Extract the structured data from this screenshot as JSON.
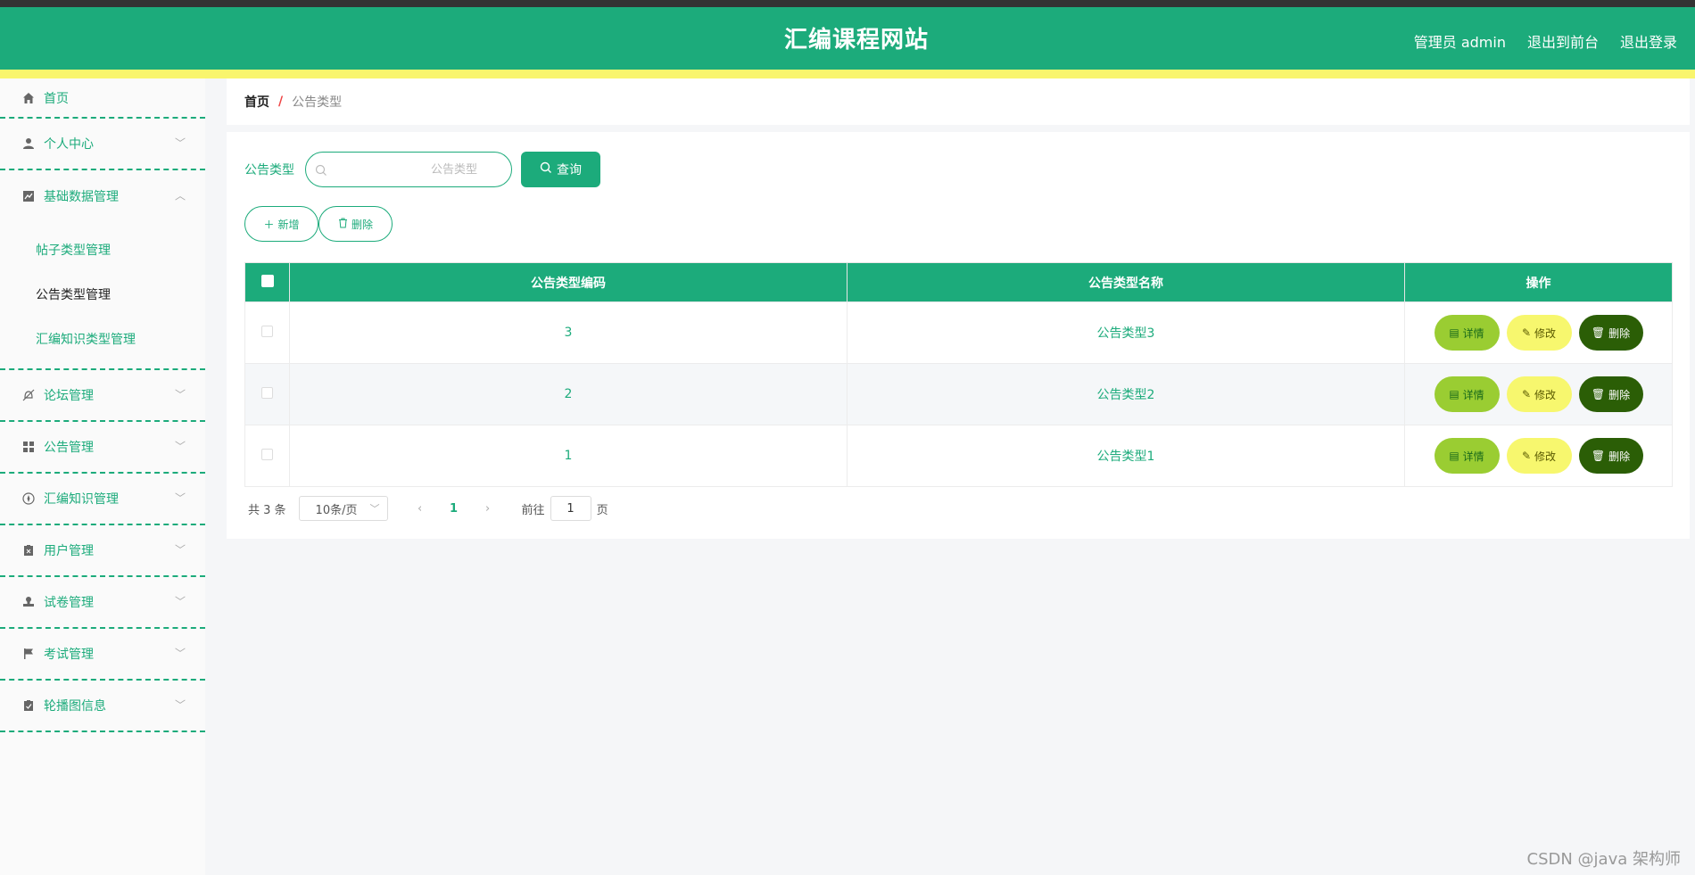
{
  "header": {
    "title": "汇编课程网站",
    "user": "管理员 admin",
    "to_front": "退出到前台",
    "logout": "退出登录"
  },
  "sidebar": {
    "home": {
      "label": "首页",
      "icon": "home-icon"
    },
    "items": [
      {
        "label": "个人中心",
        "icon": "user-icon"
      },
      {
        "label": "基础数据管理",
        "icon": "chart-icon"
      },
      {
        "label": "论坛管理",
        "icon": "bell-off-icon"
      },
      {
        "label": "公告管理",
        "icon": "grid-icon"
      },
      {
        "label": "汇编知识管理",
        "icon": "compass-icon"
      },
      {
        "label": "用户管理",
        "icon": "clipboard-icon"
      },
      {
        "label": "试卷管理",
        "icon": "stamp-icon"
      },
      {
        "label": "考试管理",
        "icon": "flag-icon"
      },
      {
        "label": "轮播图信息",
        "icon": "checklist-icon"
      }
    ],
    "submenu": [
      {
        "label": "帖子类型管理"
      },
      {
        "label": "公告类型管理"
      },
      {
        "label": "汇编知识类型管理"
      }
    ]
  },
  "breadcrumb": {
    "home": "首页",
    "separator": "/",
    "current": "公告类型"
  },
  "search": {
    "label": "公告类型",
    "placeholder": "公告类型",
    "button": "查询"
  },
  "actions": {
    "add": "新增",
    "delete": "删除"
  },
  "table": {
    "columns": [
      "公告类型编码",
      "公告类型名称",
      "操作"
    ],
    "rows": [
      {
        "code": "3",
        "name": "公告类型3"
      },
      {
        "code": "2",
        "name": "公告类型2"
      },
      {
        "code": "1",
        "name": "公告类型1"
      }
    ],
    "ops": {
      "detail": "详情",
      "edit": "修改",
      "delete": "删除"
    }
  },
  "pagination": {
    "total": "共 3 条",
    "page_size": "10条/页",
    "current_page": "1",
    "goto_label": "前往",
    "goto_value": "1",
    "page_suffix": "页"
  },
  "watermark": "CSDN @java 架构师",
  "colors": {
    "primary": "#1cab7b",
    "yellow": "#f9f56d",
    "detail": "#9acd32",
    "edit": "#f7f76e",
    "delete": "#2b5e06"
  }
}
